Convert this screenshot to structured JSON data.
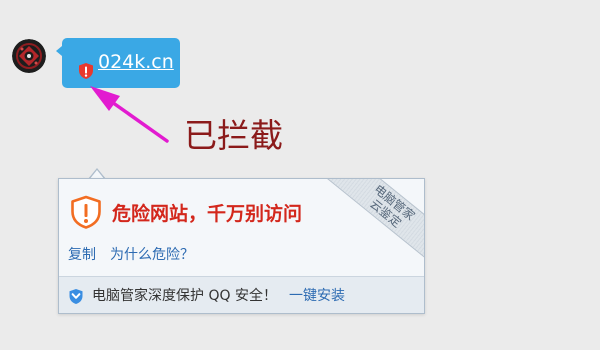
{
  "chat": {
    "link_text": "024k.cn",
    "avatar_icon": "avatar",
    "link_warning_icon": "warning-shield-icon"
  },
  "annotation": {
    "blocked_label": "已拦截"
  },
  "popup": {
    "warning_icon": "danger-shield-icon",
    "warning_title": "危险网站，千万别访问",
    "ribbon": {
      "line1": "电脑管家",
      "line2": "云鉴定"
    },
    "actions": {
      "copy_label": "复制",
      "why_label": "为什么危险？"
    },
    "footer": {
      "shield_icon": "guard-shield-icon",
      "promo_text": "电脑管家深度保护 QQ 安全！",
      "install_label": "一键安装"
    }
  },
  "colors": {
    "page_background": "#ebebeb",
    "bubble": "#3aa8e5",
    "blocked_label": "#8b1a1a",
    "danger_title": "#d3271c",
    "link": "#2d6bb2",
    "arrow": "#e21bd0"
  }
}
